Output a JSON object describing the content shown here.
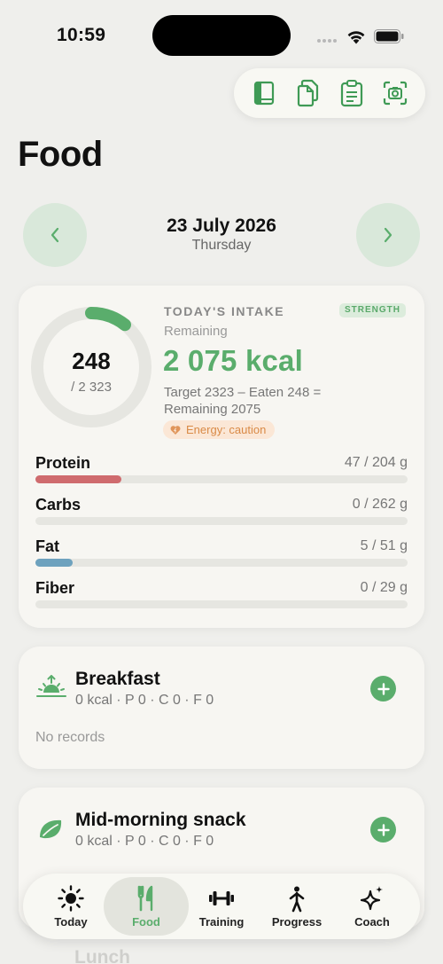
{
  "status_bar": {
    "time": "10:59"
  },
  "toolbar": {
    "icons": [
      "book-icon",
      "copy-icon",
      "clipboard-icon",
      "camera-scan-icon"
    ]
  },
  "page": {
    "title": "Food"
  },
  "date_nav": {
    "date": "23 July 2026",
    "weekday": "Thursday"
  },
  "intake": {
    "title": "TODAY'S INTAKE",
    "badge": "STRENGTH",
    "remaining_label": "Remaining",
    "remaining_kcal": "2 075 kcal",
    "formula": "Target 2323 – Eaten 248 = Remaining 2075",
    "energy_badge": "Energy: caution",
    "ring_value": "248",
    "ring_target": "/ 2 323",
    "ring_progress": 0.107,
    "macros": [
      {
        "name": "Protein",
        "value": "47 / 204 g",
        "progress": 0.23,
        "color": "#cf6b6e"
      },
      {
        "name": "Carbs",
        "value": "0 / 262 g",
        "progress": 0.0,
        "color": "#e0b45a"
      },
      {
        "name": "Fat",
        "value": "5 / 51 g",
        "progress": 0.1,
        "color": "#6ea2be"
      },
      {
        "name": "Fiber",
        "value": "0 / 29 g",
        "progress": 0.0,
        "color": "#7fbf85"
      }
    ]
  },
  "meals": [
    {
      "name": "Breakfast",
      "macros": "0 kcal · P 0 · C 0 · F 0",
      "empty_text": "No records",
      "icon": "sunrise-icon"
    },
    {
      "name": "Mid-morning snack",
      "macros": "0 kcal · P 0 · C 0 · F 0",
      "icon": "leaf-icon"
    },
    {
      "name": "Lunch"
    }
  ],
  "tabs": [
    {
      "label": "Today",
      "icon": "sun-icon",
      "active": false
    },
    {
      "label": "Food",
      "icon": "fork-knife-icon",
      "active": true
    },
    {
      "label": "Training",
      "icon": "dumbbell-icon",
      "active": false
    },
    {
      "label": "Progress",
      "icon": "figure-icon",
      "active": false
    },
    {
      "label": "Coach",
      "icon": "sparkles-icon",
      "active": false
    }
  ],
  "colors": {
    "accent": "#5aad6c",
    "background": "#efefec",
    "card": "#f7f6f2"
  }
}
